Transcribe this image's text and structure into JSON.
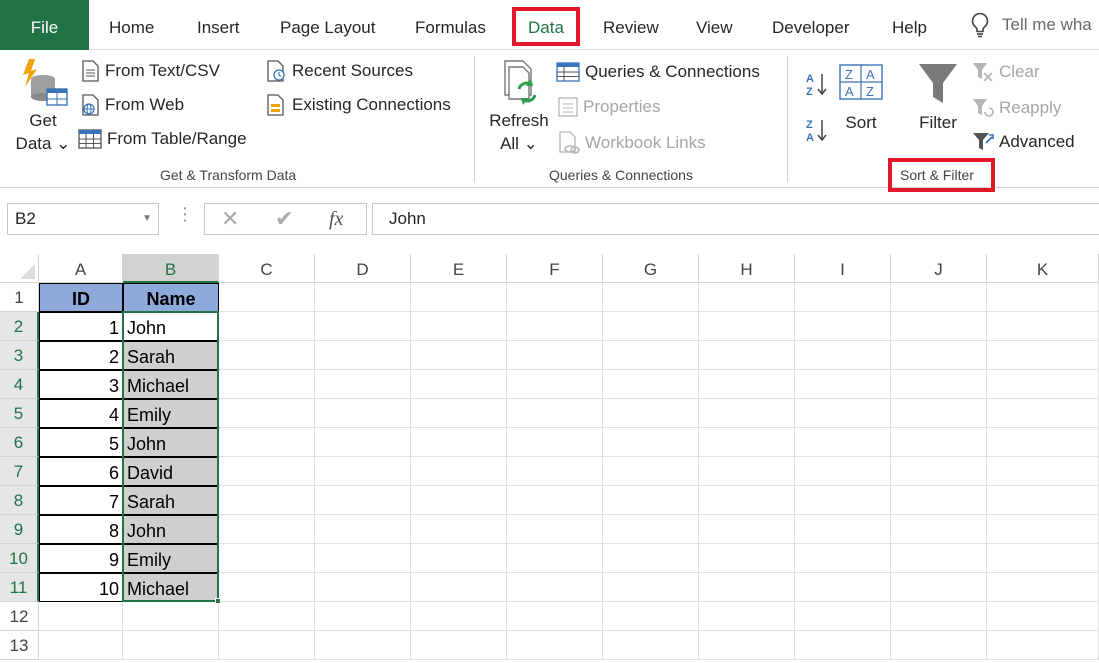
{
  "tabs": {
    "file": "File",
    "home": "Home",
    "insert": "Insert",
    "page_layout": "Page Layout",
    "formulas": "Formulas",
    "data": "Data",
    "review": "Review",
    "view": "View",
    "developer": "Developer",
    "help": "Help",
    "tell_me": "Tell me wha"
  },
  "ribbon": {
    "get_data": {
      "line1": "Get",
      "line2": "Data ⌄"
    },
    "from_text_csv": "From Text/CSV",
    "from_web": "From Web",
    "from_table_range": "From Table/Range",
    "recent_sources": "Recent Sources",
    "existing_connections": "Existing Connections",
    "group_get_transform": "Get & Transform Data",
    "refresh_all": {
      "line1": "Refresh",
      "line2": "All ⌄"
    },
    "queries_connections": "Queries & Connections",
    "properties": "Properties",
    "workbook_links": "Workbook Links",
    "group_queries": "Queries & Connections",
    "sort": "Sort",
    "filter": "Filter",
    "clear": "Clear",
    "reapply": "Reapply",
    "advanced": "Advanced",
    "group_sort_filter": "Sort & Filter"
  },
  "formula_bar": {
    "name_box": "B2",
    "fx": "fx",
    "content": "John"
  },
  "columns": [
    "A",
    "B",
    "C",
    "D",
    "E",
    "F",
    "G",
    "H",
    "I",
    "J",
    "K"
  ],
  "rows": [
    "1",
    "2",
    "3",
    "4",
    "5",
    "6",
    "7",
    "8",
    "9",
    "10",
    "11",
    "12",
    "13"
  ],
  "table": {
    "headers": [
      "ID",
      "Name"
    ],
    "data": [
      [
        "1",
        "John"
      ],
      [
        "2",
        "Sarah"
      ],
      [
        "3",
        "Michael"
      ],
      [
        "4",
        "Emily"
      ],
      [
        "5",
        "John"
      ],
      [
        "6",
        "David"
      ],
      [
        "7",
        "Sarah"
      ],
      [
        "8",
        "John"
      ],
      [
        "9",
        "Emily"
      ],
      [
        "10",
        "Michael"
      ]
    ]
  },
  "colors": {
    "excel_green": "#217346",
    "highlight_red": "#e3162a",
    "header_fill": "#8eaadb",
    "selection_fill": "#d0cece"
  }
}
